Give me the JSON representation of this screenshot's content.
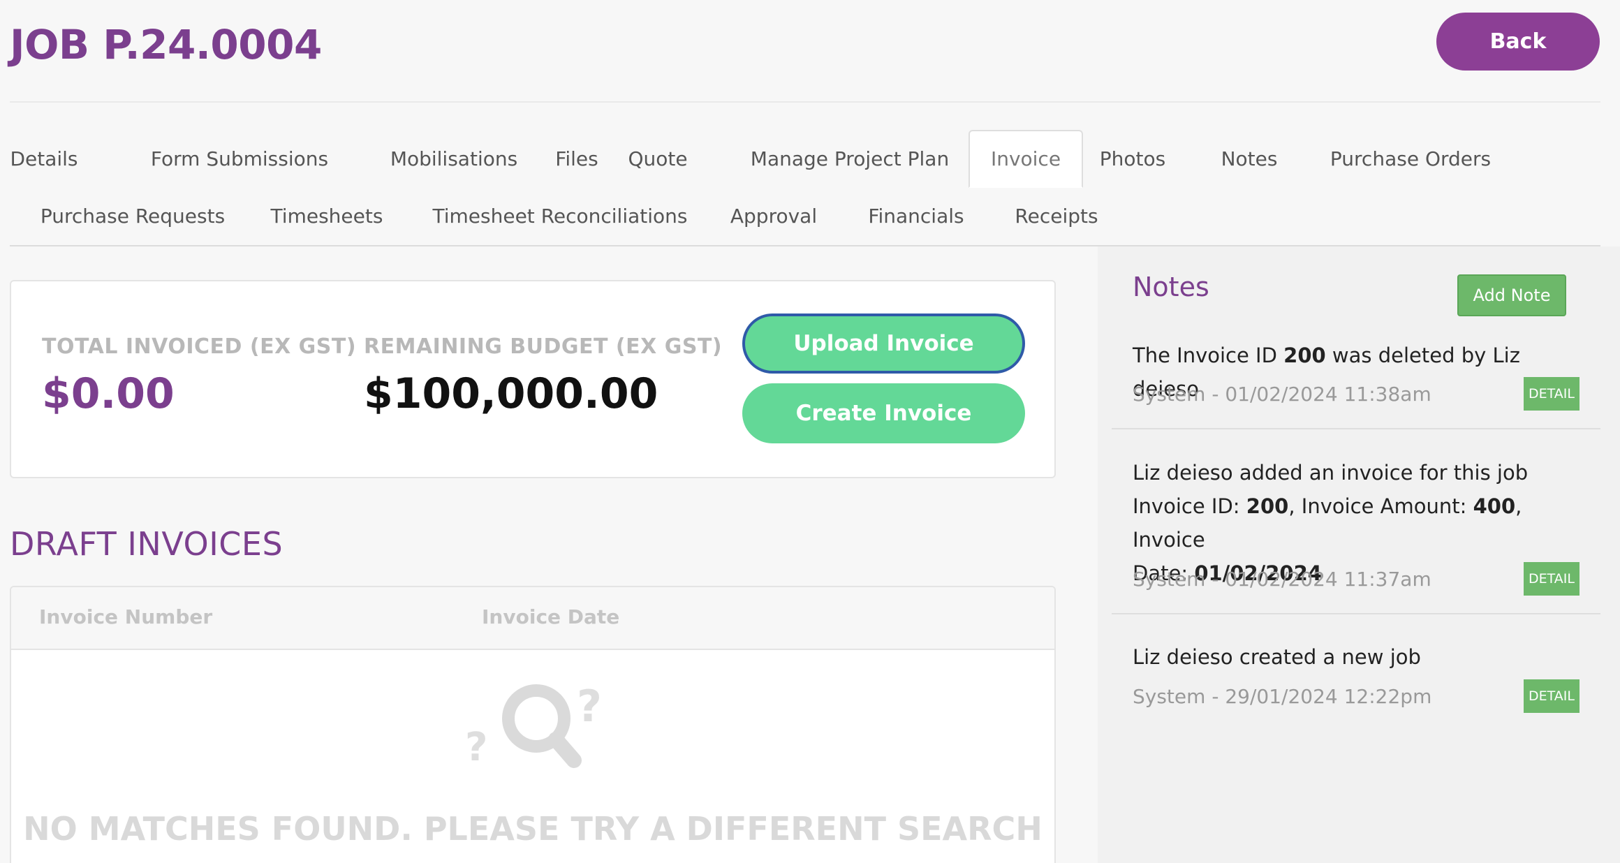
{
  "header": {
    "title": "JOB P.24.0004",
    "back_label": "Back"
  },
  "tabs": [
    {
      "label": "Details"
    },
    {
      "label": "Form Submissions"
    },
    {
      "label": "Mobilisations"
    },
    {
      "label": "Files"
    },
    {
      "label": "Quote"
    },
    {
      "label": "Manage Project Plan"
    },
    {
      "label": "Invoice",
      "active": true
    },
    {
      "label": "Photos"
    },
    {
      "label": "Notes"
    },
    {
      "label": "Purchase Orders"
    },
    {
      "label": "Purchase Requests"
    },
    {
      "label": "Timesheets"
    },
    {
      "label": "Timesheet Reconciliations"
    },
    {
      "label": "Approval"
    },
    {
      "label": "Financials"
    },
    {
      "label": "Receipts"
    }
  ],
  "summary": {
    "total_invoiced_label": "TOTAL INVOICED (EX GST)",
    "total_invoiced_value": "$0.00",
    "remaining_budget_label": "REMAINING BUDGET (EX GST)",
    "remaining_budget_value": "$100,000.00",
    "upload_label": "Upload Invoice",
    "create_label": "Create Invoice"
  },
  "draft_invoices": {
    "title": "DRAFT INVOICES",
    "columns": [
      "Invoice Number",
      "Invoice Date"
    ],
    "empty_text": "NO MATCHES FOUND. PLEASE TRY A DIFFERENT SEARCH"
  },
  "notes": {
    "title": "Notes",
    "add_label": "Add Note",
    "detail_label": "DETAIL",
    "items": [
      {
        "text_parts": [
          "The Invoice ID ",
          "200",
          " was deleted by Liz deieso"
        ],
        "meta": "System - 01/02/2024 11:38am"
      },
      {
        "line1": "Liz deieso added an invoice for this job",
        "line2_parts": [
          "Invoice ID: ",
          "200",
          ", Invoice Amount: ",
          "400",
          ", Invoice"
        ],
        "line3_parts": [
          "Date: ",
          "01/02/2024"
        ],
        "meta": "System - 01/02/2024 11:37am"
      },
      {
        "text": "Liz deieso created a new job",
        "meta": "System - 29/01/2024 12:22pm"
      }
    ]
  },
  "colors": {
    "brand_purple": "#7b3f8e",
    "button_purple": "#8c3f95",
    "accent_green": "#63d897",
    "note_green": "#6db86a"
  }
}
